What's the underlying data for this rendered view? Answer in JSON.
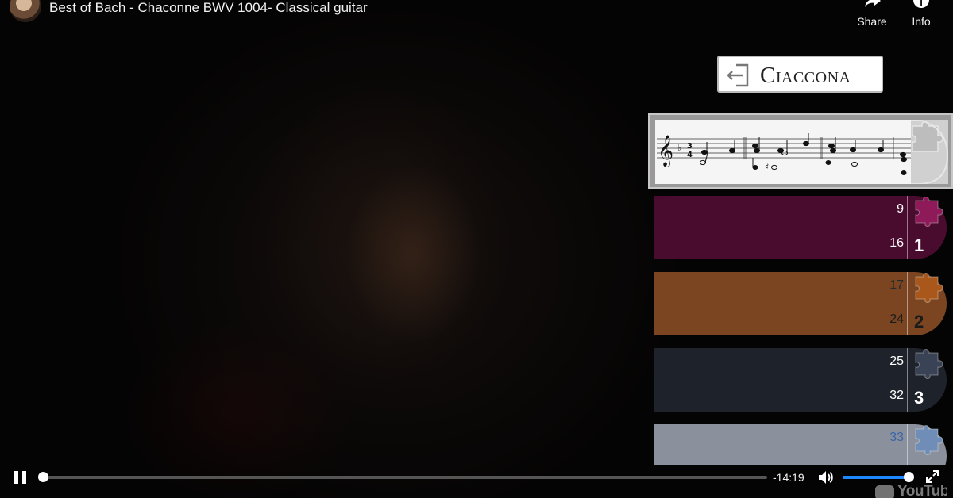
{
  "header": {
    "title": "Best of Bach - Chaconne BWV 1004- Classical guitar",
    "share_label": "Share",
    "info_label": "Info"
  },
  "overlay": {
    "logo_text": "Ciaccona",
    "sections": [
      {
        "start": "9",
        "end": "16",
        "number": "1",
        "color": "#4a0c2e",
        "piece_color": "#8e1a5a",
        "text_color": "#ffffff",
        "start_color": "#ffffff"
      },
      {
        "start": "17",
        "end": "24",
        "number": "2",
        "color": "#7a4520",
        "piece_color": "#a9571b",
        "text_color": "#1b1b1b",
        "start_color": "#2a2a2a"
      },
      {
        "start": "25",
        "end": "32",
        "number": "3",
        "color": "#1e222a",
        "piece_color": "#3a4356",
        "text_color": "#ffffff",
        "start_color": "#ffffff"
      },
      {
        "start": "33",
        "end": "",
        "number": "",
        "color": "#8a919c",
        "piece_color": "#6f8db6",
        "text_color": "#ffffff",
        "start_color": "#3a66a8"
      }
    ]
  },
  "player": {
    "time_remaining": "-14:19",
    "progress": 0.0,
    "volume": 1.0,
    "watermark_text": "YouTube"
  },
  "icons": {
    "pause": "pause-icon",
    "volume": "volume-icon",
    "fullscreen": "fullscreen-icon",
    "share": "share-icon",
    "info": "info-icon",
    "back": "back-arrow-icon",
    "puzzle": "puzzle-piece-icon"
  }
}
